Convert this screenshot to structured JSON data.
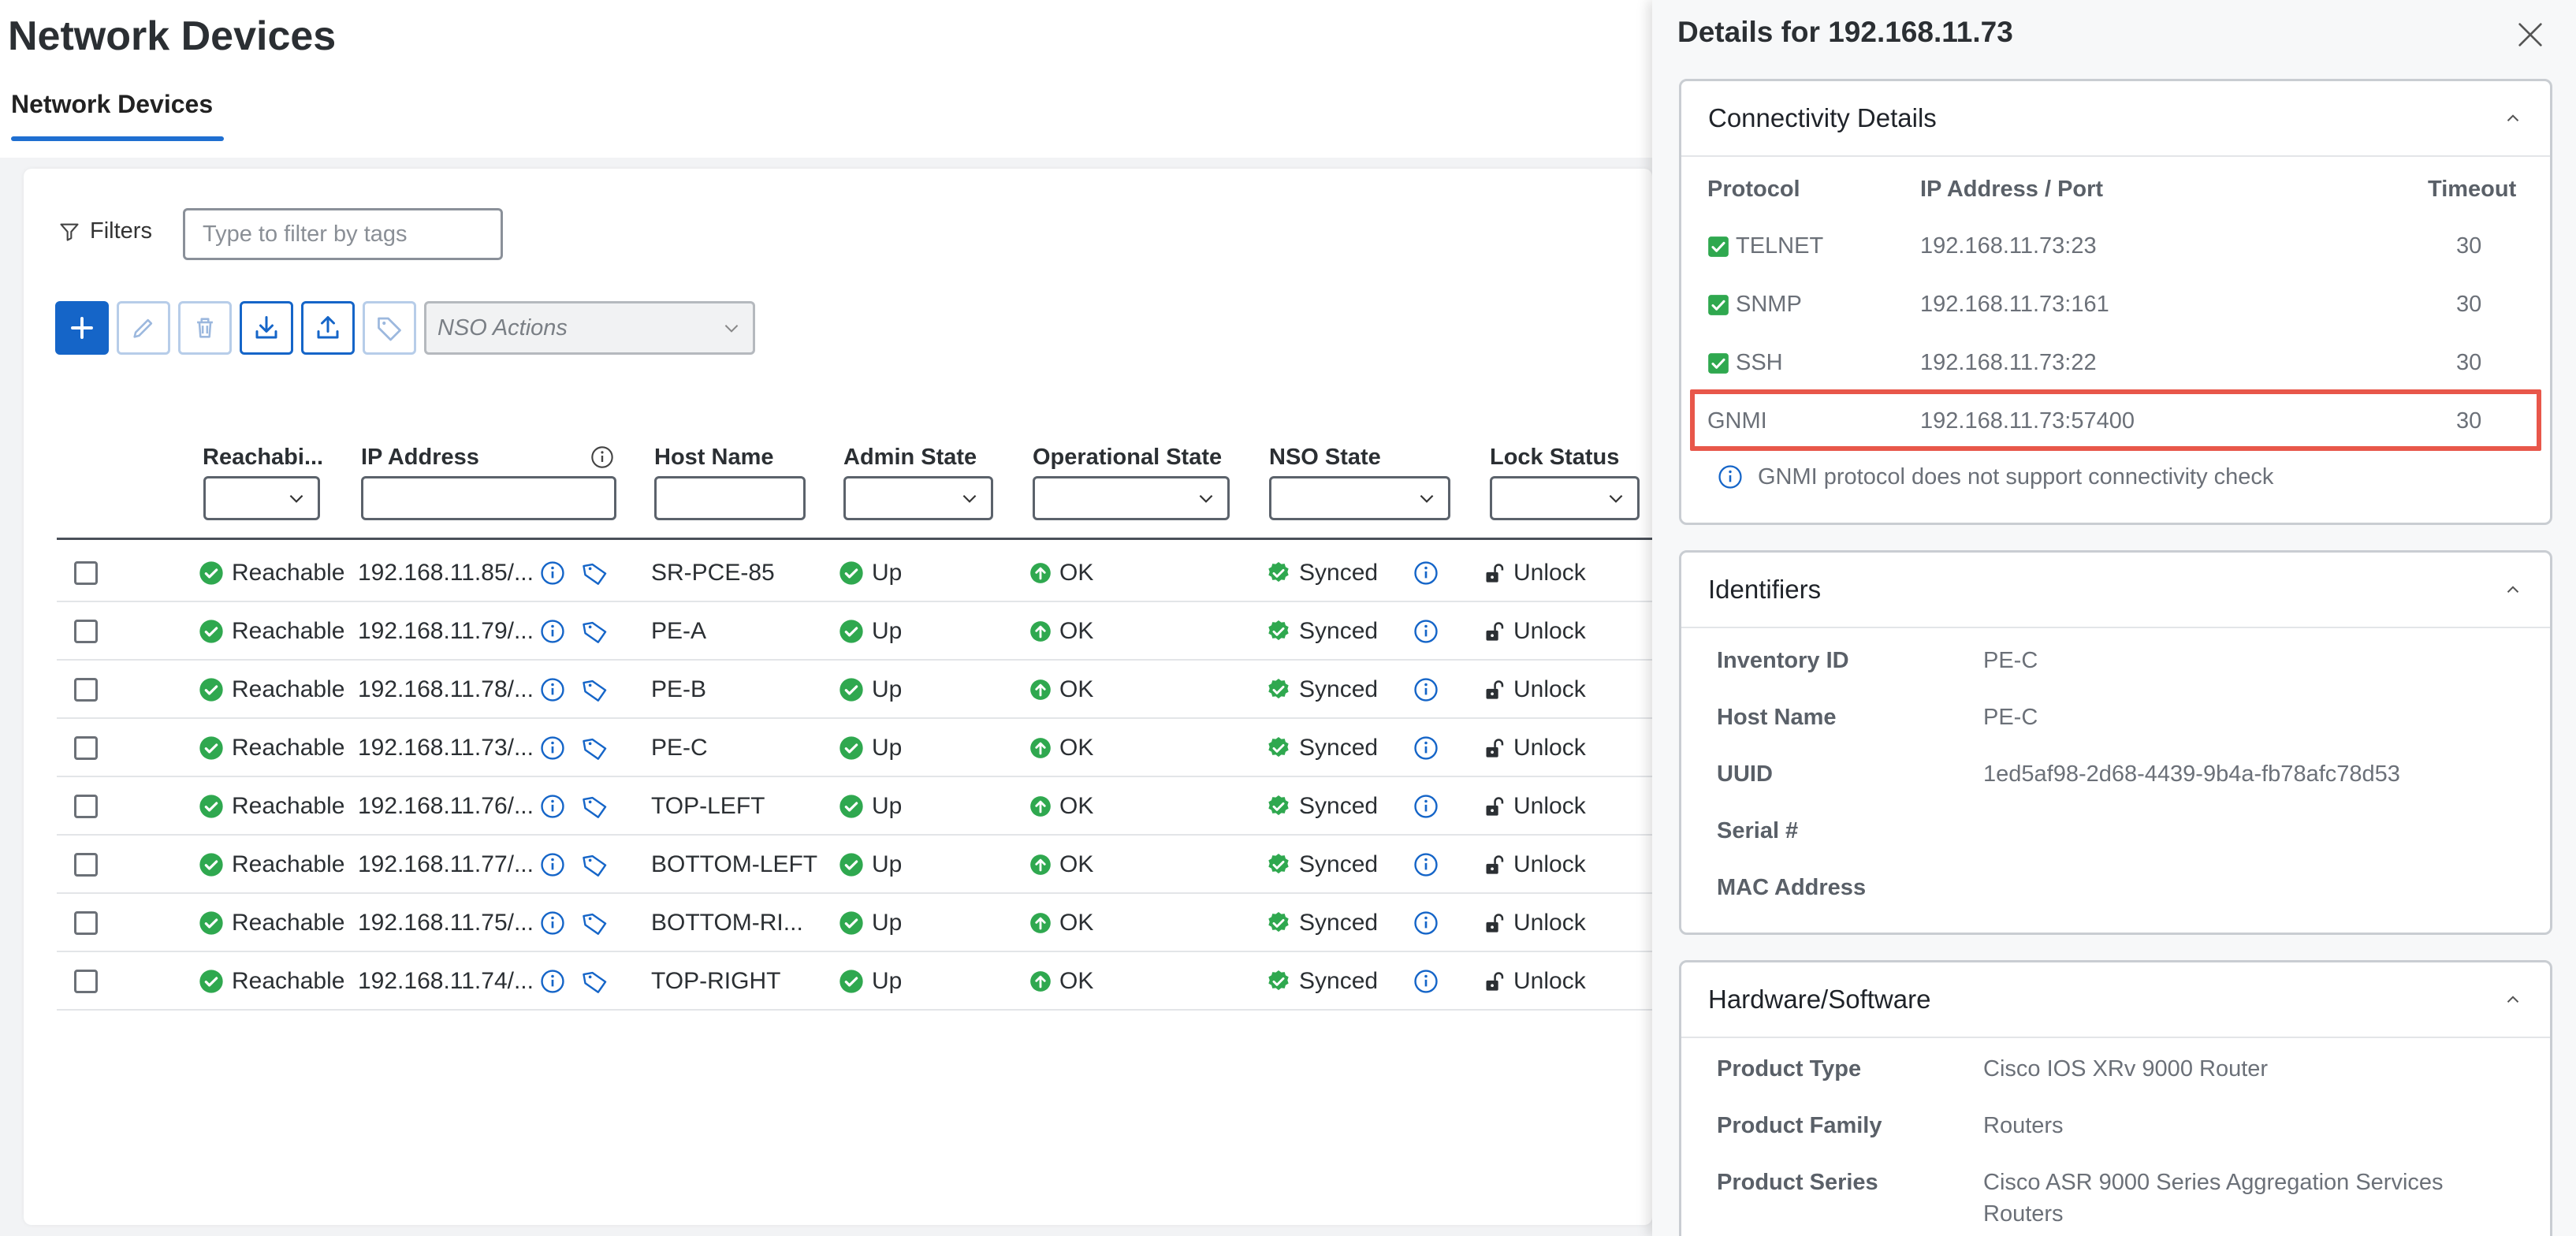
{
  "page": {
    "title": "Network Devices",
    "tab": "Network Devices"
  },
  "filters": {
    "label": "Filters",
    "placeholder": "Type to filter by tags"
  },
  "toolbar": {
    "nso_actions_placeholder": "NSO Actions"
  },
  "table": {
    "columns": {
      "reachability": "Reachabi...",
      "ip": "IP Address",
      "host": "Host Name",
      "admin": "Admin State",
      "oper": "Operational State",
      "nso": "NSO State",
      "lock": "Lock Status"
    },
    "rows": [
      {
        "reach": "Reachable",
        "ip": "192.168.11.85/...",
        "host": "SR-PCE-85",
        "admin": "Up",
        "oper": "OK",
        "nso": "Synced",
        "lock": "Unlock"
      },
      {
        "reach": "Reachable",
        "ip": "192.168.11.79/...",
        "host": "PE-A",
        "admin": "Up",
        "oper": "OK",
        "nso": "Synced",
        "lock": "Unlock"
      },
      {
        "reach": "Reachable",
        "ip": "192.168.11.78/...",
        "host": "PE-B",
        "admin": "Up",
        "oper": "OK",
        "nso": "Synced",
        "lock": "Unlock"
      },
      {
        "reach": "Reachable",
        "ip": "192.168.11.73/...",
        "host": "PE-C",
        "admin": "Up",
        "oper": "OK",
        "nso": "Synced",
        "lock": "Unlock"
      },
      {
        "reach": "Reachable",
        "ip": "192.168.11.76/...",
        "host": "TOP-LEFT",
        "admin": "Up",
        "oper": "OK",
        "nso": "Synced",
        "lock": "Unlock"
      },
      {
        "reach": "Reachable",
        "ip": "192.168.11.77/...",
        "host": "BOTTOM-LEFT",
        "admin": "Up",
        "oper": "OK",
        "nso": "Synced",
        "lock": "Unlock"
      },
      {
        "reach": "Reachable",
        "ip": "192.168.11.75/...",
        "host": "BOTTOM-RI...",
        "admin": "Up",
        "oper": "OK",
        "nso": "Synced",
        "lock": "Unlock"
      },
      {
        "reach": "Reachable",
        "ip": "192.168.11.74/...",
        "host": "TOP-RIGHT",
        "admin": "Up",
        "oper": "OK",
        "nso": "Synced",
        "lock": "Unlock"
      }
    ]
  },
  "drawer": {
    "title": "Details for 192.168.11.73",
    "connectivity": {
      "title": "Connectivity Details",
      "headers": {
        "protocol": "Protocol",
        "address": "IP Address / Port",
        "timeout": "Timeout"
      },
      "rows": [
        {
          "protocol": "TELNET",
          "address": "192.168.11.73:23",
          "timeout": "30",
          "checked": true
        },
        {
          "protocol": "SNMP",
          "address": "192.168.11.73:161",
          "timeout": "30",
          "checked": true
        },
        {
          "protocol": "SSH",
          "address": "192.168.11.73:22",
          "timeout": "30",
          "checked": true
        },
        {
          "protocol": "GNMI",
          "address": "192.168.11.73:57400",
          "timeout": "30",
          "checked": false
        }
      ],
      "note": "GNMI protocol does not support connectivity check"
    },
    "identifiers": {
      "title": "Identifiers",
      "items": [
        {
          "key": "Inventory ID",
          "value": "PE-C"
        },
        {
          "key": "Host Name",
          "value": "PE-C"
        },
        {
          "key": "UUID",
          "value": "1ed5af98-2d68-4439-9b4a-fb78afc78d53"
        },
        {
          "key": "Serial #",
          "value": ""
        },
        {
          "key": "MAC Address",
          "value": ""
        }
      ]
    },
    "hardware": {
      "title": "Hardware/Software",
      "items": [
        {
          "key": "Product Type",
          "value": "Cisco IOS XRv 9000 Router"
        },
        {
          "key": "Product Family",
          "value": "Routers"
        },
        {
          "key": "Product Series",
          "value": "Cisco ASR 9000 Series Aggregation Services",
          "value2": "Routers"
        }
      ]
    }
  },
  "colors": {
    "accent": "#1565c8",
    "success": "#2fa84f",
    "highlight": "#e8574a"
  }
}
